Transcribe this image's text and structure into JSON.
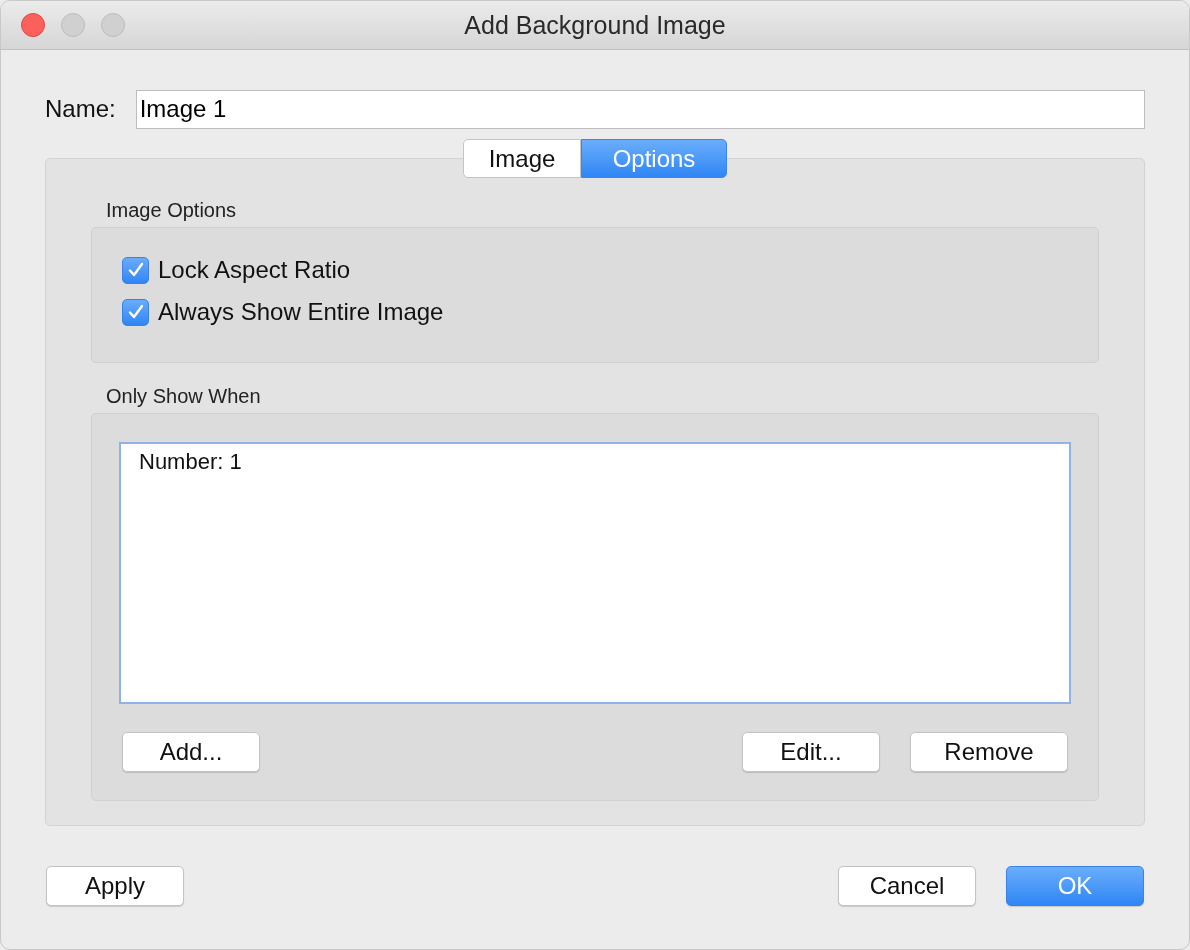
{
  "window": {
    "title": "Add Background Image"
  },
  "name_field": {
    "label": "Name:",
    "value": "Image 1"
  },
  "tabs": [
    {
      "label": "Image",
      "selected": false
    },
    {
      "label": "Options",
      "selected": true
    }
  ],
  "image_options": {
    "title": "Image Options",
    "checkboxes": [
      {
        "label": "Lock Aspect Ratio",
        "checked": true
      },
      {
        "label": "Always Show Entire Image",
        "checked": true
      }
    ]
  },
  "only_show_when": {
    "title": "Only Show When",
    "items": [
      {
        "label": "Number: 1"
      }
    ],
    "buttons": [
      "Add...",
      "Edit...",
      "Remove"
    ]
  },
  "footer": {
    "buttons": [
      {
        "label": "Apply",
        "default": false
      },
      {
        "label": "Cancel",
        "default": false
      },
      {
        "label": "OK",
        "default": true
      }
    ]
  }
}
